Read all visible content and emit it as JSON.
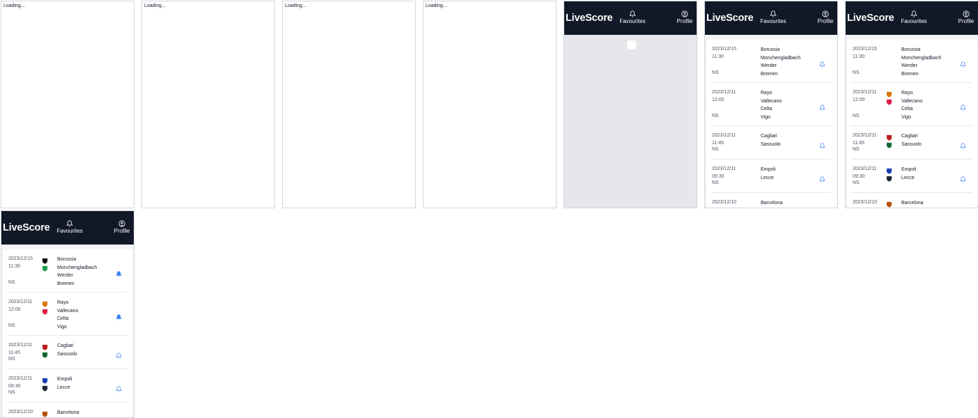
{
  "loading_text": "Loading...",
  "app": {
    "logo": "LiveScore",
    "nav_favourites": "Favourites",
    "nav_profile": "Profile"
  },
  "matches": [
    {
      "date": "2023/12/15",
      "time": "11:30",
      "status": "NS",
      "home": "Borussia Monchengladbach",
      "away": "Werder Bremen",
      "home_lines": [
        "Borussia",
        "Monchengladbach"
      ],
      "away_lines": [
        "Werder",
        "Bremen"
      ],
      "home_crest": "borussia-crest",
      "away_crest": "werder-crest"
    },
    {
      "date": "2023/12/11",
      "time": "12:00",
      "status": "NS",
      "home": "Rayo Vallecano",
      "away": "Celta Vigo",
      "home_lines": [
        "Rayo",
        "Vallecano"
      ],
      "away_lines": [
        "Celta",
        "Vigo"
      ],
      "home_crest": "rayo-crest",
      "away_crest": "celta-crest"
    },
    {
      "date": "2023/12/11",
      "time": "11:45",
      "status": "NS",
      "home": "Cagliari",
      "away": "Sassuolo",
      "home_lines": [
        "Cagliari"
      ],
      "away_lines": [
        "Sassuolo"
      ],
      "home_crest": "cagliari-crest",
      "away_crest": "sassuolo-crest"
    },
    {
      "date": "2023/12/11",
      "time": "09:30",
      "status": "NS",
      "home": "Empoli",
      "away": "Lecce",
      "home_lines": [
        "Empoli"
      ],
      "away_lines": [
        "Lecce"
      ],
      "home_crest": "empoli-crest",
      "away_crest": "lecce-crest"
    },
    {
      "date": "2023/12/10",
      "time": "",
      "status": "",
      "home": "Barcelona",
      "away": "",
      "home_lines": [
        "Barcelona"
      ],
      "away_lines": [],
      "home_crest": "barcelona-crest",
      "away_crest": ""
    }
  ],
  "colors": {
    "nav_bg": "#111827",
    "accent": "#3b82f6",
    "grey_bg": "#e5e7eb"
  }
}
